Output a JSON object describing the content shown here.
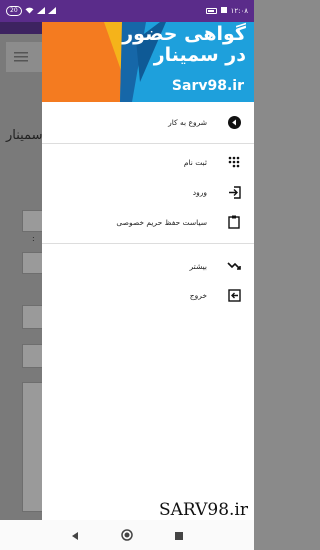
{
  "status_bar": {
    "left_pill": "20",
    "time": "۱۲:۰۸"
  },
  "background": {
    "title_fragment": "سمینار",
    "label_fragment": ":"
  },
  "drawer": {
    "banner": {
      "title": "گواهی حضور در سمینار",
      "site": "Sarv98.ir",
      "colors": {
        "blue": "#1ea0dc",
        "orange": "#f47b20",
        "yellow": "#f5b31a",
        "dark_blue": "#1667a8"
      }
    },
    "items": [
      {
        "label": "شروع به کار",
        "icon": "play-circle-icon"
      },
      {
        "label": "ثبت نام",
        "icon": "dialpad-icon"
      },
      {
        "label": "ورود",
        "icon": "login-icon"
      },
      {
        "label": "سیاست حفظ حریم خصوصی",
        "icon": "clipboard-icon"
      },
      {
        "label": "بیشتر",
        "icon": "trending-down-icon"
      },
      {
        "label": "خروج",
        "icon": "logout-icon"
      }
    ]
  },
  "watermark": "SARV98.ir",
  "accent": "#5a2c8a"
}
